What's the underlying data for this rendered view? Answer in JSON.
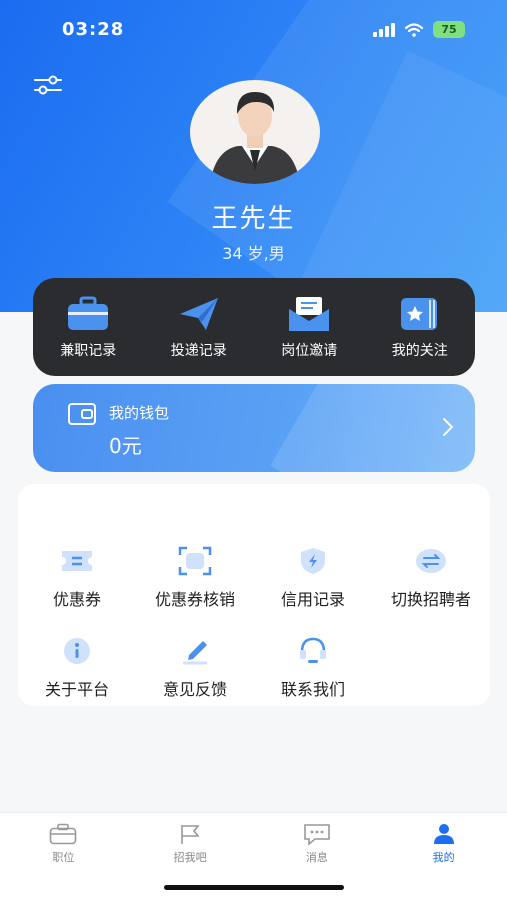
{
  "status_bar": {
    "time": "03:28",
    "battery": "75"
  },
  "profile": {
    "name": "王先生",
    "meta": "34 岁,男"
  },
  "quick_actions": [
    {
      "label": "兼职记录",
      "icon": "briefcase-icon"
    },
    {
      "label": "投递记录",
      "icon": "paper-plane-icon"
    },
    {
      "label": "岗位邀请",
      "icon": "envelope-icon"
    },
    {
      "label": "我的关注",
      "icon": "star-book-icon"
    }
  ],
  "wallet": {
    "title": "我的钱包",
    "amount": "0元"
  },
  "menu": [
    {
      "label": "优惠券",
      "icon": "coupon-icon"
    },
    {
      "label": "优惠券核销",
      "icon": "scan-icon"
    },
    {
      "label": "信用记录",
      "icon": "shield-icon"
    },
    {
      "label": "切换招聘者",
      "icon": "switch-icon"
    },
    {
      "label": "关于平台",
      "icon": "info-icon"
    },
    {
      "label": "意见反馈",
      "icon": "pen-icon"
    },
    {
      "label": "联系我们",
      "icon": "headset-icon"
    }
  ],
  "tabbar": [
    {
      "label": "职位",
      "icon": "briefcase-icon",
      "active": false
    },
    {
      "label": "招我吧",
      "icon": "flag-icon",
      "active": false
    },
    {
      "label": "消息",
      "icon": "message-icon",
      "active": false
    },
    {
      "label": "我的",
      "icon": "person-icon",
      "active": true
    }
  ],
  "colors": {
    "primary": "#1d6ff2",
    "panel_dark": "#2b2c2f",
    "icon_blue": "#4b92ee"
  }
}
